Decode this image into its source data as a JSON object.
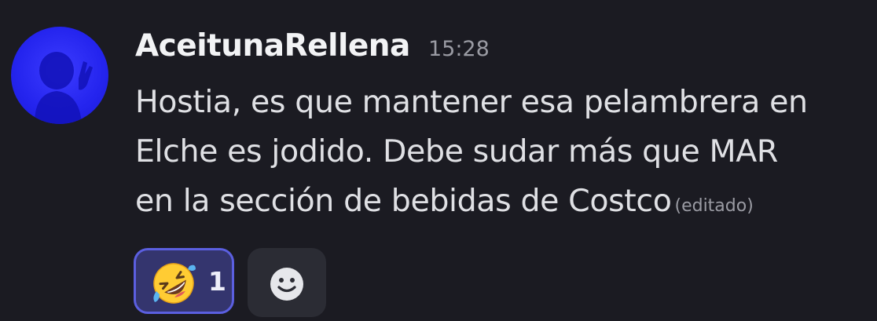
{
  "message": {
    "author": "AceitunaRellena",
    "timestamp": "15:28",
    "content_lines": [
      "Hostia, es que mantener esa pelambrera en",
      "Elche es jodido. Debe sudar más que MAR",
      "en la sección de bebidas de Costco"
    ],
    "edited_label": "(editado)"
  },
  "reactions": [
    {
      "emoji": "rolling-on-floor-laughing",
      "count": "1",
      "selected": true
    }
  ],
  "add_reaction_icon": "smiley-face-icon",
  "colors": {
    "background": "#1b1b22",
    "avatar": "#2a2af0",
    "reaction_border": "#5b5fe0",
    "reaction_bg": "#34356e"
  }
}
